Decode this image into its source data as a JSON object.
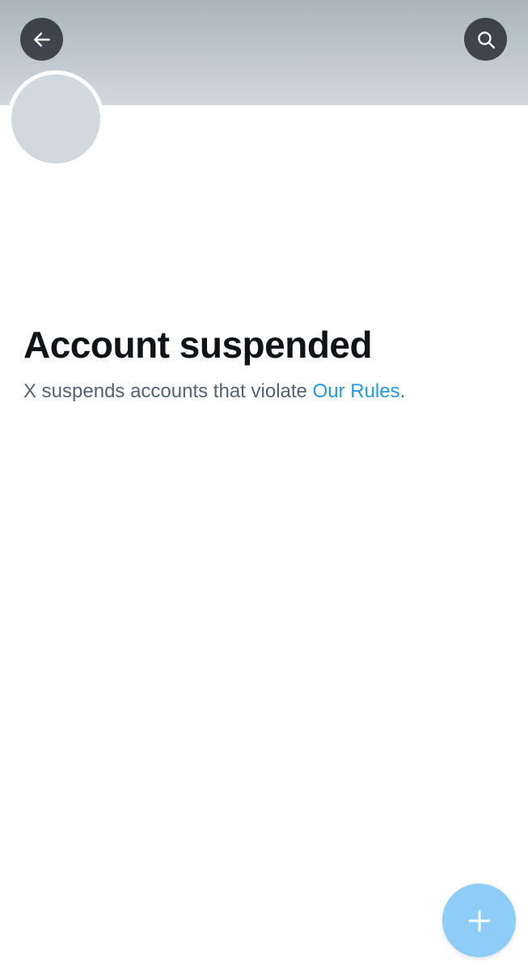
{
  "header": {
    "back_icon": "arrow-left-icon",
    "search_icon": "search-icon"
  },
  "profile": {
    "display_name": "",
    "handle": ""
  },
  "suspension": {
    "title": "Account suspended",
    "description_prefix": "X suspends accounts that violate ",
    "rules_link": "Our Rules",
    "description_suffix": "."
  },
  "fab": {
    "icon": "plus-icon"
  },
  "colors": {
    "banner_top": "#aab4bc",
    "banner_bottom": "#cfd9de",
    "accent": "#1d9bf0",
    "fab": "#8ecdf8",
    "secondary_text": "#536471"
  }
}
